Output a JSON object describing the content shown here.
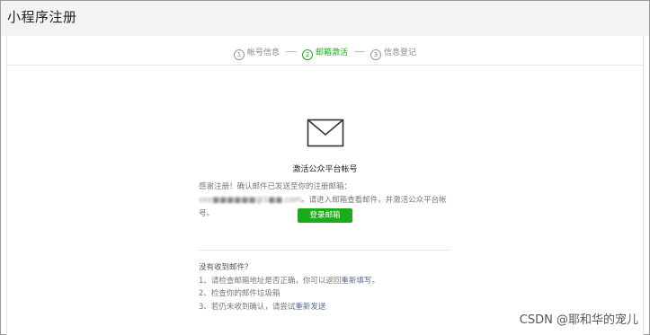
{
  "window": {
    "title": "小程序注册"
  },
  "steps": [
    {
      "num": "1",
      "label": "帐号信息",
      "active": false
    },
    {
      "num": "2",
      "label": "邮箱激活",
      "active": true
    },
    {
      "num": "3",
      "label": "信息登记",
      "active": false
    }
  ],
  "activation": {
    "icon": "envelope-icon",
    "title": "激活公众平台帐号",
    "message_prefix": "感谢注册！确认邮件已发送至你的注册邮箱：",
    "email": "vxx■■■■■■@1■■.com",
    "message_suffix": "。请进入邮箱查看邮件，并激活公众平台帐号。",
    "login_button": "登录邮箱"
  },
  "help": {
    "question": "没有收到邮件？",
    "item1_text": "1、请检查邮箱地址是否正确，你可以返回",
    "item1_link": "重新填写",
    "item1_end": "。",
    "item2_text": "2、检查你的邮件垃圾箱",
    "item3_text": "3、若仍未收到确认，请尝试",
    "item3_link": "重新发送"
  },
  "watermark": "CSDN @耶和华的宠儿",
  "colors": {
    "accent": "#1aad19",
    "link": "#576b95"
  }
}
